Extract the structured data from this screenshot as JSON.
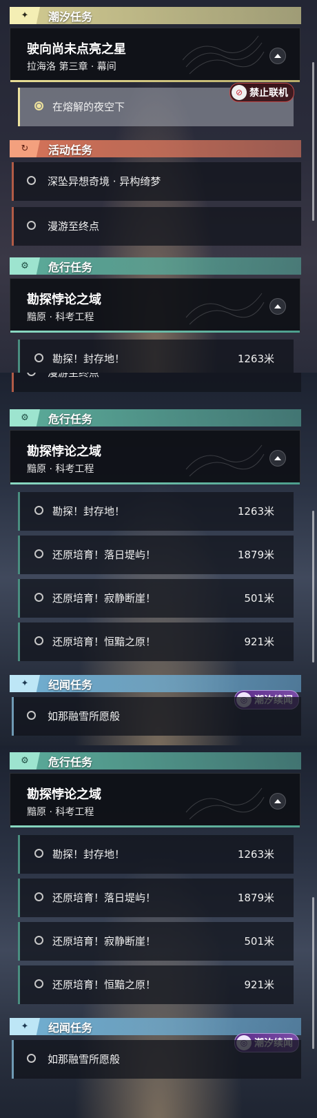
{
  "colors": {
    "yellow": "#e8dd95",
    "orange": "#e0785a",
    "teal": "#5fb4a0",
    "blue": "#78b9dc",
    "lock_red": "#c24a4a",
    "story_purple": "#7a4ca6"
  },
  "icons": {
    "tide": "sparkle-icon",
    "activity": "cycle-arrow-icon",
    "danger": "gear-eye-icon",
    "chronicle": "sparkle-icon",
    "collapse": "chevron-up-icon",
    "radio": "circle-icon",
    "lock": "no-coop-icon",
    "story": "swirl-icon"
  },
  "panel1": {
    "tide": {
      "category": "潮汐任务",
      "main_title": "驶向尚未点亮之星",
      "main_sub": "拉海洛 第三章 · 幕间",
      "active_row": "在熔解的夜空下",
      "lock_tag": "禁止联机"
    },
    "activity": {
      "category": "活动任务",
      "rows": [
        "深坠异想奇境 · 异构绮梦",
        "漫游至终点"
      ]
    },
    "danger": {
      "category": "危行任务",
      "main_title": "勘探悖论之域",
      "main_sub": "黯原 · 科考工程",
      "partial_row": "勘探！封存地！",
      "partial_dist": "1263米"
    }
  },
  "panel2": {
    "partial_top": "漫游至终点",
    "danger": {
      "category": "危行任务",
      "main_title": "勘探悖论之域",
      "main_sub": "黯原 · 科考工程",
      "rows": [
        {
          "text": "勘探！封存地！",
          "dist": "1263米"
        },
        {
          "text": "还原培育！落日堤屿！",
          "dist": "1879米"
        },
        {
          "text": "还原培育！寂静断崖！",
          "dist": "501米"
        },
        {
          "text": "还原培育！恒黯之原！",
          "dist": "921米"
        }
      ]
    },
    "chronicle": {
      "category": "纪闻任务",
      "story_tag": "潮汐续闻",
      "row": "如那融雪所愿般"
    }
  },
  "panel3": {
    "danger": {
      "category": "危行任务",
      "main_title": "勘探悖论之域",
      "main_sub": "黯原 · 科考工程",
      "rows": [
        {
          "text": "勘探！封存地！",
          "dist": "1263米"
        },
        {
          "text": "还原培育！落日堤屿！",
          "dist": "1879米"
        },
        {
          "text": "还原培育！寂静断崖！",
          "dist": "501米"
        },
        {
          "text": "还原培育！恒黯之原！",
          "dist": "921米"
        }
      ]
    },
    "chronicle": {
      "category": "纪闻任务",
      "story_tag": "潮汐续闻",
      "row": "如那融雪所愿般"
    }
  }
}
